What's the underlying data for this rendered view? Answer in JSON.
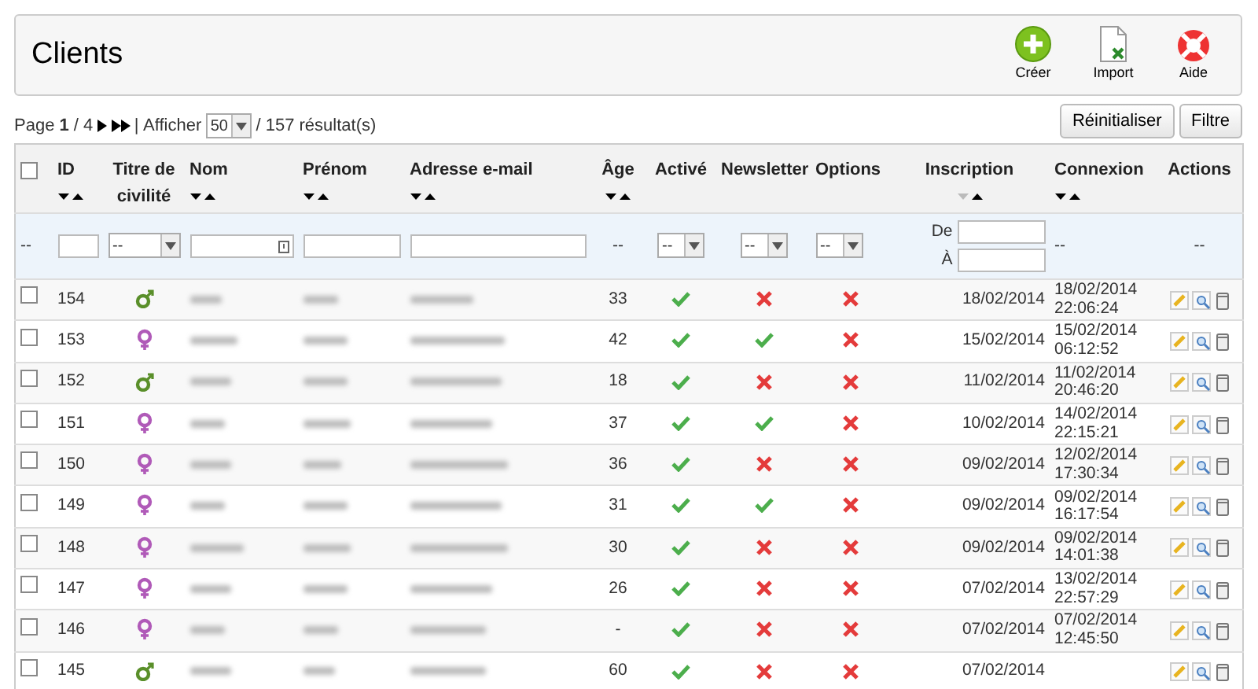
{
  "header": {
    "title": "Clients",
    "buttons": [
      {
        "kind": "create",
        "label": "Créer"
      },
      {
        "kind": "import",
        "label": "Import"
      },
      {
        "kind": "help",
        "label": "Aide"
      }
    ]
  },
  "pagination": {
    "page_text": "Page **1** / 4",
    "divider": "|",
    "show_label": "Afficher",
    "per_page": "50",
    "results": "/ 157 résultat(s)"
  },
  "list_buttons": [
    "Réinitialiser",
    "Filtre"
  ],
  "table": {
    "all_checked": false,
    "columns": [
      {
        "kind": "check"
      },
      {
        "kind": "text",
        "label": "ID",
        "sortable": true,
        "sorted": false
      },
      {
        "kind": "text",
        "label": "Titre de civilité",
        "sortable": false
      },
      {
        "kind": "text",
        "label": "Nom",
        "sortable": true,
        "sorted": false
      },
      {
        "kind": "text",
        "label": "Prénom",
        "sortable": true,
        "sorted": false
      },
      {
        "kind": "text",
        "label": "Adresse e-mail",
        "sortable": true,
        "sorted": false
      },
      {
        "kind": "text",
        "label": "Âge",
        "sortable": true,
        "sorted": false
      },
      {
        "kind": "text",
        "label": "Activé",
        "sortable": false
      },
      {
        "kind": "text",
        "label": "Newsletter",
        "sortable": false
      },
      {
        "kind": "text",
        "label": "Options",
        "sortable": false
      },
      {
        "kind": "text",
        "label": "Inscription",
        "sortable": true,
        "sorted": true
      },
      {
        "kind": "text",
        "label": "Connexion",
        "sortable": true,
        "sorted": false
      },
      {
        "kind": "text",
        "label": "Actions",
        "sortable": false
      }
    ],
    "filters": [
      {
        "kind": "dash",
        "text": "--"
      },
      {
        "kind": "input"
      },
      {
        "kind": "select",
        "value": "--"
      },
      {
        "kind": "input",
        "icon": true
      },
      {
        "kind": "input"
      },
      {
        "kind": "input"
      },
      {
        "kind": "dash",
        "text": "--"
      },
      {
        "kind": "select",
        "value": "--"
      },
      {
        "kind": "select",
        "value": "--"
      },
      {
        "kind": "select",
        "value": "--"
      },
      {
        "kind": "daterange",
        "from_label": "De",
        "to_label": "À"
      },
      {
        "kind": "dash",
        "text": "--"
      },
      {
        "kind": "dash",
        "text": "--"
      }
    ],
    "rows": [
      {
        "checked": false,
        "id": "154",
        "kind": "male",
        "age": "33",
        "active": true,
        "newsletter": false,
        "optin": false,
        "signup": "18/02/2014",
        "last_date": "18/02/2014",
        "last_time": "22:06:24"
      },
      {
        "checked": false,
        "id": "153",
        "kind": "female",
        "age": "42",
        "active": true,
        "newsletter": true,
        "optin": false,
        "signup": "15/02/2014",
        "last_date": "15/02/2014",
        "last_time": "06:12:52"
      },
      {
        "checked": false,
        "id": "152",
        "kind": "male",
        "age": "18",
        "active": true,
        "newsletter": false,
        "optin": false,
        "signup": "11/02/2014",
        "last_date": "11/02/2014",
        "last_time": "20:46:20"
      },
      {
        "checked": false,
        "id": "151",
        "kind": "female",
        "age": "37",
        "active": true,
        "newsletter": true,
        "optin": false,
        "signup": "10/02/2014",
        "last_date": "14/02/2014",
        "last_time": "22:15:21"
      },
      {
        "checked": false,
        "id": "150",
        "kind": "female",
        "age": "36",
        "active": true,
        "newsletter": false,
        "optin": false,
        "signup": "09/02/2014",
        "last_date": "12/02/2014",
        "last_time": "17:30:34"
      },
      {
        "checked": false,
        "id": "149",
        "kind": "female",
        "age": "31",
        "active": true,
        "newsletter": true,
        "optin": false,
        "signup": "09/02/2014",
        "last_date": "09/02/2014",
        "last_time": "16:17:54"
      },
      {
        "checked": false,
        "id": "148",
        "kind": "female",
        "age": "30",
        "active": true,
        "newsletter": false,
        "optin": false,
        "signup": "09/02/2014",
        "last_date": "09/02/2014",
        "last_time": "14:01:38"
      },
      {
        "checked": false,
        "id": "147",
        "kind": "female",
        "age": "26",
        "active": true,
        "newsletter": false,
        "optin": false,
        "signup": "07/02/2014",
        "last_date": "13/02/2014",
        "last_time": "22:57:29"
      },
      {
        "checked": false,
        "id": "146",
        "kind": "female",
        "age": "-",
        "active": true,
        "newsletter": false,
        "optin": false,
        "signup": "07/02/2014",
        "last_date": "07/02/2014",
        "last_time": "12:45:50"
      },
      {
        "checked": false,
        "id": "145",
        "kind": "male",
        "age": "60",
        "active": true,
        "newsletter": false,
        "optin": false,
        "signup": "07/02/2014"
      }
    ]
  }
}
